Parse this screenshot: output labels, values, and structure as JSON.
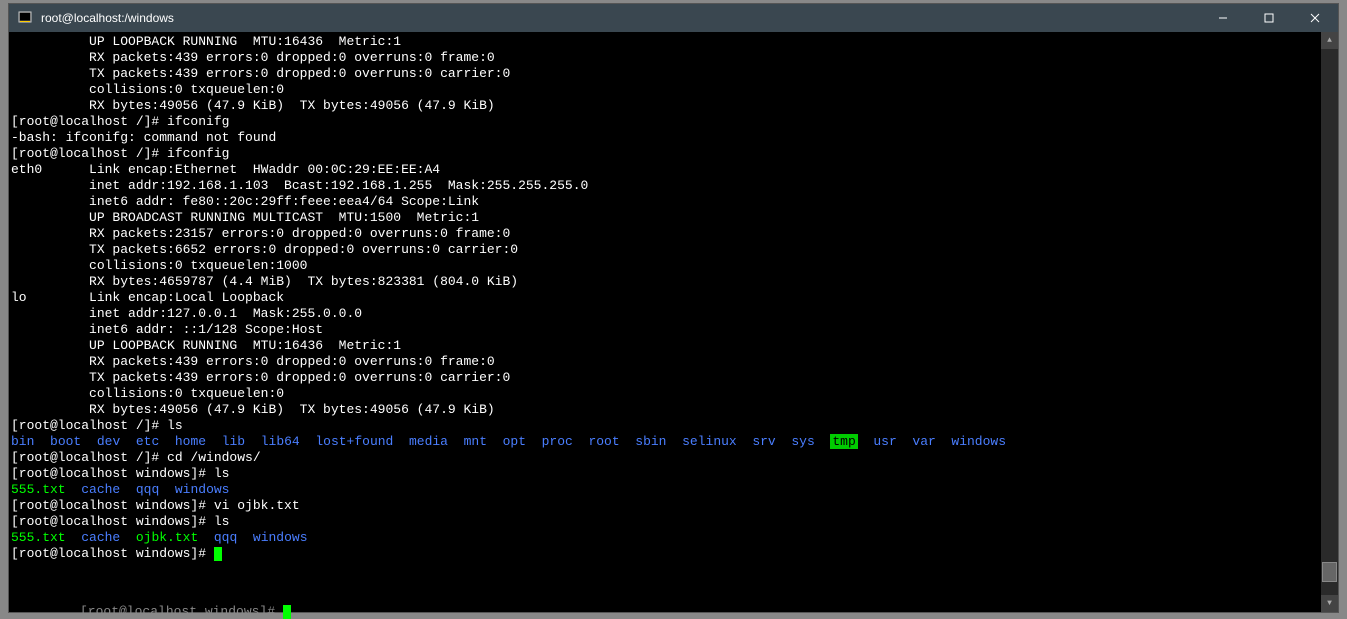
{
  "window": {
    "title": "root@localhost:/windows"
  },
  "terminal": {
    "lines": [
      "          UP LOOPBACK RUNNING  MTU:16436  Metric:1",
      "          RX packets:439 errors:0 dropped:0 overruns:0 frame:0",
      "          TX packets:439 errors:0 dropped:0 overruns:0 carrier:0",
      "          collisions:0 txqueuelen:0",
      "          RX bytes:49056 (47.9 KiB)  TX bytes:49056 (47.9 KiB)",
      "",
      "[root@localhost /]# ifconifg",
      "-bash: ifconifg: command not found",
      "[root@localhost /]# ifconfig",
      "eth0      Link encap:Ethernet  HWaddr 00:0C:29:EE:EE:A4",
      "          inet addr:192.168.1.103  Bcast:192.168.1.255  Mask:255.255.255.0",
      "          inet6 addr: fe80::20c:29ff:feee:eea4/64 Scope:Link",
      "          UP BROADCAST RUNNING MULTICAST  MTU:1500  Metric:1",
      "          RX packets:23157 errors:0 dropped:0 overruns:0 frame:0",
      "          TX packets:6652 errors:0 dropped:0 overruns:0 carrier:0",
      "          collisions:0 txqueuelen:1000",
      "          RX bytes:4659787 (4.4 MiB)  TX bytes:823381 (804.0 KiB)",
      "",
      "lo        Link encap:Local Loopback",
      "          inet addr:127.0.0.1  Mask:255.0.0.0",
      "          inet6 addr: ::1/128 Scope:Host",
      "          UP LOOPBACK RUNNING  MTU:16436  Metric:1",
      "          RX packets:439 errors:0 dropped:0 overruns:0 frame:0",
      "          TX packets:439 errors:0 dropped:0 overruns:0 carrier:0",
      "          collisions:0 txqueuelen:0",
      "          RX bytes:49056 (47.9 KiB)  TX bytes:49056 (47.9 KiB)",
      "",
      "[root@localhost /]# ls"
    ],
    "ls_root": [
      "bin",
      "boot",
      "dev",
      "etc",
      "home",
      "lib",
      "lib64",
      "lost+found",
      "media",
      "mnt",
      "opt",
      "proc",
      "root",
      "sbin",
      "selinux",
      "srv",
      "sys",
      "tmp",
      "usr",
      "var",
      "windows"
    ],
    "after_ls": [
      "[root@localhost /]# cd /windows/",
      "[root@localhost windows]# ls"
    ],
    "ls_windows1": {
      "green": [
        "555.txt"
      ],
      "blue": [
        "cache",
        "qqq",
        "windows"
      ]
    },
    "after_ls1": [
      "[root@localhost windows]# vi ojbk.txt",
      "[root@localhost windows]# ls"
    ],
    "ls_windows2": {
      "items": [
        {
          "text": "555.txt",
          "color": "green"
        },
        {
          "text": "cache",
          "color": "blue"
        },
        {
          "text": "ojbk.txt",
          "color": "green"
        },
        {
          "text": "qqq",
          "color": "blue"
        },
        {
          "text": "windows",
          "color": "blue"
        }
      ]
    },
    "final_prompt": "[root@localhost windows]# ",
    "shadow": "[root@localhost windows]# "
  }
}
